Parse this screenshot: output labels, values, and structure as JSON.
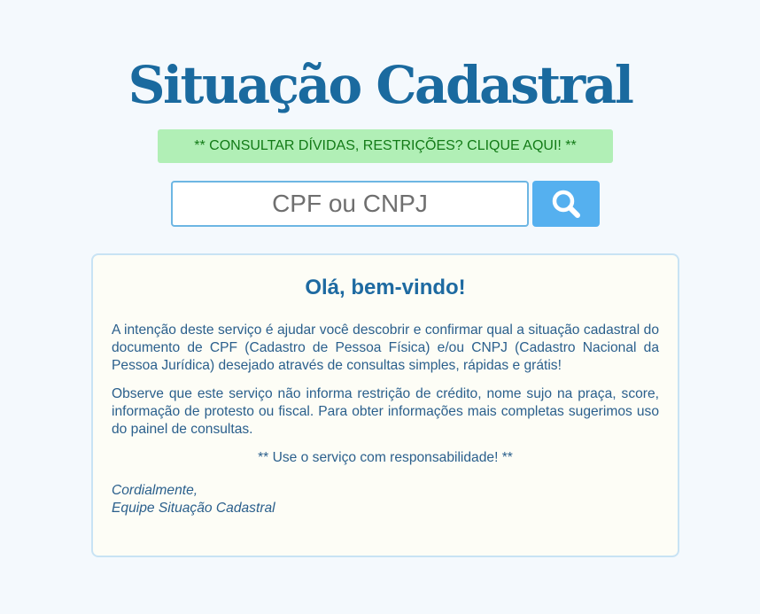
{
  "header": {
    "title": "Situação Cadastral",
    "promo_text": "** CONSULTAR DÍVIDAS, RESTRIÇÕES? CLIQUE AQUI! **"
  },
  "search": {
    "placeholder": "CPF ou CNPJ",
    "value": "",
    "button_icon": "search-icon"
  },
  "welcome": {
    "heading": "Olá, bem-vindo!",
    "paragraph_1": "A intenção deste serviço é ajudar você descobrir e confirmar qual a situação cadastral do documento de CPF (Cadastro de Pessoa Física) e/ou CNPJ (Cadastro Nacional da Pessoa Jurídica) desejado através de consultas simples, rápidas e grátis!",
    "paragraph_2": "Observe que este serviço não informa restrição de crédito, nome sujo na praça, score, informação de protesto ou fiscal. Para obter informações mais completas sugerimos uso do painel de consultas.",
    "note": "** Use o serviço com responsabilidade! **",
    "signoff_line_1": "Cordialmente,",
    "signoff_line_2": "Equipe Situação Cadastral"
  },
  "colors": {
    "background": "#f4f9fd",
    "title": "#1a6a9f",
    "promo_background": "#b1efb6",
    "promo_text": "#127a16",
    "search_border": "#6db6e3",
    "search_button": "#55b0ef",
    "card_background": "#fdfdf6",
    "card_border": "#c8e3f4",
    "body_text": "#2a5f8c"
  }
}
